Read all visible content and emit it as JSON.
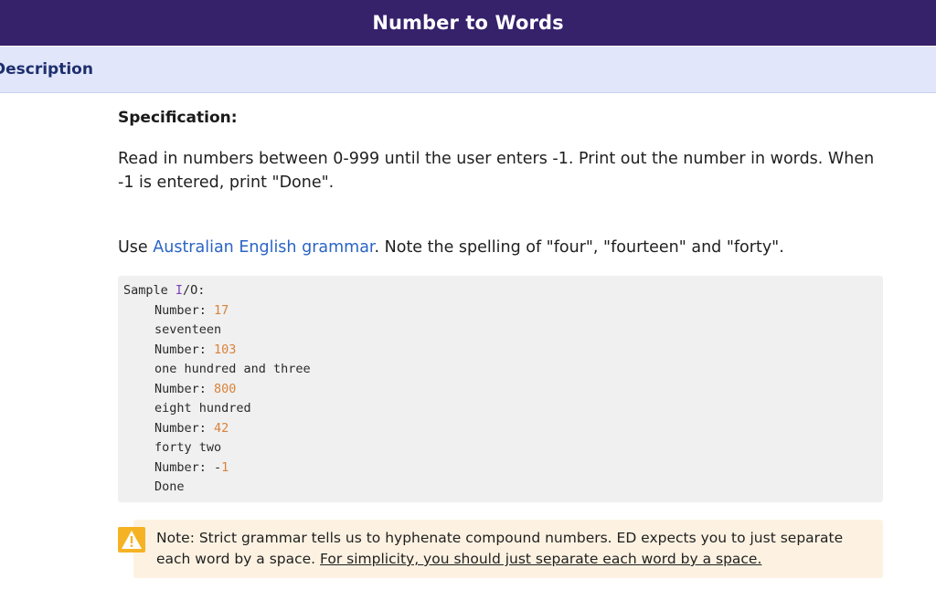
{
  "header": {
    "title": "Number to Words"
  },
  "tabs": [
    {
      "label": "Description"
    }
  ],
  "spec": {
    "heading": "Specification:",
    "paragraph1": "Read in numbers between 0-999 until the user enters -1. Print out the number in words. When -1 is entered, print \"Done\".",
    "p2_prefix": "Use ",
    "p2_link": "Australian English grammar",
    "p2_suffix": ". Note the spelling of \"four\", \"fourteen\" and \"forty\"."
  },
  "sample": {
    "title_prefix": "Sample ",
    "title_kw": "I",
    "title_suffix": "/O:",
    "prompt_label": "Number: ",
    "lines": [
      {
        "kind": "prompt",
        "value": "17"
      },
      {
        "kind": "output",
        "text": "seventeen"
      },
      {
        "kind": "prompt",
        "value": "103"
      },
      {
        "kind": "output",
        "text": "one hundred and three"
      },
      {
        "kind": "prompt",
        "value": "800"
      },
      {
        "kind": "output",
        "text": "eight hundred"
      },
      {
        "kind": "prompt",
        "value": "42"
      },
      {
        "kind": "output",
        "text": "forty two"
      },
      {
        "kind": "prompt_neg",
        "sign": "-",
        "value": "1"
      },
      {
        "kind": "output",
        "text": "Done"
      }
    ]
  },
  "note": {
    "icon": "warning-icon",
    "text": "Note: Strict grammar tells us to hyphenate compound numbers. ED expects you to just separate each word by a space. ",
    "underlined": "For simplicity, you should just separate each word by a space."
  },
  "colors": {
    "header_bg": "#36216b",
    "tab_bar_bg": "#e1e6fb",
    "link": "#2a64c5",
    "code_number": "#d9823a",
    "code_keyword": "#7a3fb8",
    "note_bg": "#fdf2e2",
    "warning": "#f5b324"
  }
}
